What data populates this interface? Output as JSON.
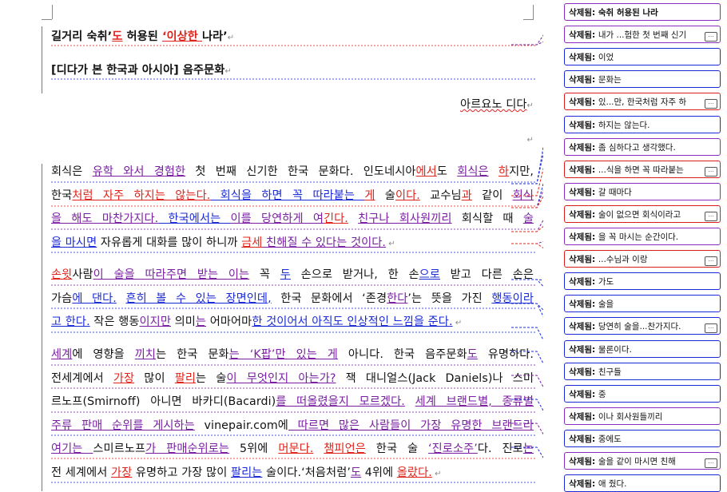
{
  "document": {
    "title_line": [
      {
        "text": "길거리 숙취’",
        "style": "bold"
      },
      {
        "text": "도",
        "style": "bold ins-r"
      },
      {
        "text": " 허용된 ",
        "style": "bold"
      },
      {
        "text": "‘이상한 ",
        "style": "bold ins-r"
      },
      {
        "text": "나라’",
        "style": "bold"
      }
    ],
    "subtitle_line": [
      {
        "text": "[디다가 본 한국과 아시아] 음주문화",
        "style": "bold"
      }
    ],
    "author_line": [
      {
        "text": "아르요노 디다",
        "style": "wavy"
      }
    ],
    "paragraph1": [
      [
        {
          "text": "회식은 ",
          "style": ""
        },
        {
          "text": "유학 와서 경험한",
          "style": "ins-p"
        },
        {
          "text": " 첫 번째 신기한 한국 문화다. 인도네시아",
          "style": ""
        },
        {
          "text": "에서",
          "style": "ins-r"
        },
        {
          "text": "도 ",
          "style": ""
        },
        {
          "text": "회식은",
          "style": "ins-p"
        },
        {
          "text": " ",
          "style": ""
        },
        {
          "text": "하",
          "style": "ins-r"
        },
        {
          "text": "지만,",
          "style": ""
        }
      ],
      [
        {
          "text": "한국",
          "style": ""
        },
        {
          "text": "처럼 자주 하지는 않는다.",
          "style": "ins-r"
        },
        {
          "text": " 회식을 하면 꼭 따라붙는 ",
          "style": "ins-b"
        },
        {
          "text": "게",
          "style": "ins-r"
        },
        {
          "text": " 술",
          "style": ""
        },
        {
          "text": "이다.",
          "style": "ins-r"
        },
        {
          "text": " 교수님",
          "style": ""
        },
        {
          "text": "과",
          "style": "ins-r"
        },
        {
          "text": " 같이 ",
          "style": ""
        },
        {
          "text": "회식",
          "style": "ins-p"
        }
      ],
      [
        {
          "text": "을 해도 마찬가지다.",
          "style": "ins-p"
        },
        {
          "text": " 한국에서는 ",
          "style": "ins-b"
        },
        {
          "text": "이를 당연하게 여",
          "style": "ins-p"
        },
        {
          "text": "긴다.",
          "style": "ins-r"
        },
        {
          "text": " ",
          "style": ""
        },
        {
          "text": "친구나 회사원끼리",
          "style": "ins-p"
        },
        {
          "text": " 회식할 때 ",
          "style": ""
        },
        {
          "text": "술",
          "style": "ins-p"
        }
      ],
      [
        {
          "text": "을 마시면",
          "style": "ins-b"
        },
        {
          "text": " 자유롭게 대화를 많이 하니까 ",
          "style": ""
        },
        {
          "text": "금세",
          "style": "ins-r"
        },
        {
          "text": " 친해질 수 있다는 것이다.",
          "style": "ins-p"
        },
        {
          "text": " ↵",
          "style": "pm"
        }
      ]
    ],
    "paragraph2": [
      [
        {
          "text": "손윗",
          "style": "ins-r"
        },
        {
          "text": "사람",
          "style": ""
        },
        {
          "text": "이 술을 따라주면 받는 이는",
          "style": "ins-p"
        },
        {
          "text": " 꼭 ",
          "style": ""
        },
        {
          "text": "두",
          "style": "ins-b"
        },
        {
          "text": " 손으로 받거나, 한 손",
          "style": ""
        },
        {
          "text": "으로",
          "style": "ins-b"
        },
        {
          "text": " 받고 다른 손은",
          "style": ""
        }
      ],
      [
        {
          "text": "가슴",
          "style": ""
        },
        {
          "text": "에 댄다.",
          "style": "ins-b"
        },
        {
          "text": " ",
          "style": ""
        },
        {
          "text": "흔히 볼 수 있는 장면인데,",
          "style": "ins-b"
        },
        {
          "text": " 한국 문화에서 ‘존경",
          "style": ""
        },
        {
          "text": "한다",
          "style": "ins-p"
        },
        {
          "text": "’는 뜻을 가진 ",
          "style": ""
        },
        {
          "text": "행동이라",
          "style": "ins-b"
        }
      ],
      [
        {
          "text": "고 한다.",
          "style": "ins-b"
        },
        {
          "text": " 작은 행동",
          "style": ""
        },
        {
          "text": "이지만",
          "style": "ins-p"
        },
        {
          "text": " 의미",
          "style": ""
        },
        {
          "text": "는",
          "style": "ins-p"
        },
        {
          "text": " 어마어마",
          "style": ""
        },
        {
          "text": "한 것이어서 아직도 인상적인 느낌을 준다.",
          "style": "ins-b"
        },
        {
          "text": " ↵",
          "style": "pm"
        }
      ]
    ],
    "paragraph3": [
      [
        {
          "text": "세계",
          "style": "ins-p"
        },
        {
          "text": "에 영향을 ",
          "style": ""
        },
        {
          "text": "끼치",
          "style": "ins-p"
        },
        {
          "text": "는 한국 문화",
          "style": ""
        },
        {
          "text": "는 ‘K팝’만 있는 게",
          "style": "ins-p"
        },
        {
          "text": " 아니다. 한국 음주문화",
          "style": ""
        },
        {
          "text": "도",
          "style": "ins-p"
        },
        {
          "text": " 유명하다.",
          "style": ""
        }
      ],
      [
        {
          "text": "전세계에서 ",
          "style": ""
        },
        {
          "text": "가장",
          "style": "ins-r"
        },
        {
          "text": " 많이 ",
          "style": ""
        },
        {
          "text": "팔리",
          "style": "ins-r"
        },
        {
          "text": "는 술",
          "style": ""
        },
        {
          "text": "이 무엇인지 아는가?",
          "style": "ins-p"
        },
        {
          "text": " 잭 대니얼스(Jack Daniels)나 스미",
          "style": ""
        }
      ],
      [
        {
          "text": "르노프(Smirnoff) 아니면 바카디(Bacardi)",
          "style": ""
        },
        {
          "text": "를 떠올렸을지 모르겠다.",
          "style": "ins-p"
        },
        {
          "text": " ",
          "style": ""
        },
        {
          "text": "세계 브랜드별, 종류별",
          "style": "ins-p"
        }
      ],
      [
        {
          "text": "주류 판매 순위를 게시하는",
          "style": "ins-p"
        },
        {
          "text": " vinepair.com에",
          "style": ""
        },
        {
          "text": " 따르면 많은 사람들이 가장 유명한 브랜드라",
          "style": "ins-p"
        }
      ],
      [
        {
          "text": "여기는 ",
          "style": "ins-p"
        },
        {
          "text": "스미르노프",
          "style": ""
        },
        {
          "text": "가 판매순위로는",
          "style": "ins-p"
        },
        {
          "text": " 5위에 ",
          "style": ""
        },
        {
          "text": "머문다.",
          "style": "ins-r"
        },
        {
          "text": " ",
          "style": ""
        },
        {
          "text": "챔피언은",
          "style": "ins-r"
        },
        {
          "text": " 한국 술 ",
          "style": ""
        },
        {
          "text": "‘진로소주’",
          "style": "ins-p"
        },
        {
          "text": "다. 진로",
          "style": ""
        },
        {
          "text": "는",
          "style": "ins-p"
        }
      ],
      [
        {
          "text": "전 세계에서 ",
          "style": ""
        },
        {
          "text": "가장",
          "style": "ins-r"
        },
        {
          "text": " 유명하고 가장 많이 ",
          "style": ""
        },
        {
          "text": "팔리는",
          "style": "ins-b"
        },
        {
          "text": " 술이다.",
          "style": ""
        },
        {
          "text": "‘처음처럼’",
          "style": ""
        },
        {
          "text": "도",
          "style": "ins-p"
        },
        {
          "text": " 4위에 ",
          "style": ""
        },
        {
          "text": "올랐다.",
          "style": "ins-r"
        },
        {
          "text": " ↵",
          "style": "pm"
        }
      ]
    ]
  },
  "comments": {
    "label": "삭제됨:",
    "items": [
      {
        "text": "숙취 허용된 나라",
        "color": "purple",
        "bold": true,
        "more": false
      },
      {
        "text": "내가 ...험한 첫 번째 신기",
        "color": "purple",
        "bold": false,
        "more": true
      },
      {
        "text": "이었",
        "color": "blue",
        "bold": false,
        "more": false
      },
      {
        "text": "문화는",
        "color": "blue",
        "bold": false,
        "more": false
      },
      {
        "text": "있...만, 한국처럼 자주 하",
        "color": "red",
        "bold": false,
        "more": true
      },
      {
        "text": "하지는 않는다.",
        "color": "blue",
        "bold": false,
        "more": false
      },
      {
        "text": "좀 심하다고 생각했다.",
        "color": "purple",
        "bold": false,
        "more": false
      },
      {
        "text": "...식을 하면 꼭 따라붙는",
        "color": "red",
        "bold": false,
        "more": true
      },
      {
        "text": "갈 때마다",
        "color": "purple",
        "bold": false,
        "more": false
      },
      {
        "text": "술이 없으면 회식이라고",
        "color": "red",
        "bold": false,
        "more": true
      },
      {
        "text": "을 꼭 마시는 순간이다.",
        "color": "purple",
        "bold": false,
        "more": false
      },
      {
        "text": "...수님과 이랑",
        "color": "red",
        "bold": false,
        "more": true
      },
      {
        "text": "가도",
        "color": "blue",
        "bold": false,
        "more": false
      },
      {
        "text": "술을",
        "color": "blue",
        "bold": false,
        "more": false
      },
      {
        "text": "당연히 술을...찬가지다.",
        "color": "blue",
        "bold": false,
        "more": true
      },
      {
        "text": "물론이다.",
        "color": "blue",
        "bold": false,
        "more": false
      },
      {
        "text": "친구들",
        "color": "blue",
        "bold": false,
        "more": false
      },
      {
        "text": "중",
        "color": "blue",
        "bold": false,
        "more": false
      },
      {
        "text": "이나 회사원들끼리",
        "color": "purple",
        "bold": false,
        "more": false
      },
      {
        "text": "중에도",
        "color": "blue",
        "bold": false,
        "more": false
      },
      {
        "text": "술을 같이 마시면 친해",
        "color": "purple",
        "bold": false,
        "more": true
      },
      {
        "text": "애 줬다.",
        "color": "blue",
        "bold": false,
        "more": false
      }
    ]
  },
  "colors": {
    "revision_red": "#e0241b",
    "revision_blue": "#1b2bd6",
    "revision_purple": "#7a1fa2"
  }
}
